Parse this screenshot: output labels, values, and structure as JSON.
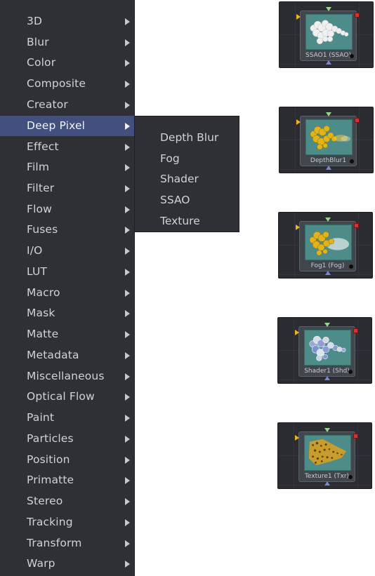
{
  "menu": {
    "items": [
      {
        "label": "3D"
      },
      {
        "label": "Blur"
      },
      {
        "label": "Color"
      },
      {
        "label": "Composite"
      },
      {
        "label": "Creator"
      },
      {
        "label": "Deep Pixel"
      },
      {
        "label": "Effect"
      },
      {
        "label": "Film"
      },
      {
        "label": "Filter"
      },
      {
        "label": "Flow"
      },
      {
        "label": "Fuses"
      },
      {
        "label": "I/O"
      },
      {
        "label": "LUT"
      },
      {
        "label": "Macro"
      },
      {
        "label": "Mask"
      },
      {
        "label": "Matte"
      },
      {
        "label": "Metadata"
      },
      {
        "label": "Miscellaneous"
      },
      {
        "label": "Optical Flow"
      },
      {
        "label": "Paint"
      },
      {
        "label": "Particles"
      },
      {
        "label": "Position"
      },
      {
        "label": "Primatte"
      },
      {
        "label": "Stereo"
      },
      {
        "label": "Tracking"
      },
      {
        "label": "Transform"
      },
      {
        "label": "Warp"
      }
    ],
    "active_item": "Deep Pixel",
    "arrow_icon": "chevron-right-icon"
  },
  "submenu": {
    "items": [
      {
        "label": "Depth Blur"
      },
      {
        "label": "Fog"
      },
      {
        "label": "Shader"
      },
      {
        "label": "SSAO"
      },
      {
        "label": "Texture"
      }
    ]
  },
  "nodes": [
    {
      "label": "SSAO1 (SSAO)",
      "preview": "white-spheres"
    },
    {
      "label": "DepthBlur1",
      "preview": "yellow-spheres-blur"
    },
    {
      "label": "Fog1 (Fog)",
      "preview": "yellow-spheres-fog"
    },
    {
      "label": "Shader1 (Shd)",
      "preview": "blue-shaded-spheres"
    },
    {
      "label": "Texture1 (Txr)",
      "preview": "textured-spheres"
    }
  ],
  "colors": {
    "menu_background": "#2e3036",
    "menu_highlight": "#424f7f",
    "menu_text": "#d2d3d6",
    "node_preview": "#4f8f8b",
    "input_port": "#efb422",
    "output_port": "#d63232",
    "top_port": "#95d38e",
    "bottom_port": "#7d86d5"
  }
}
